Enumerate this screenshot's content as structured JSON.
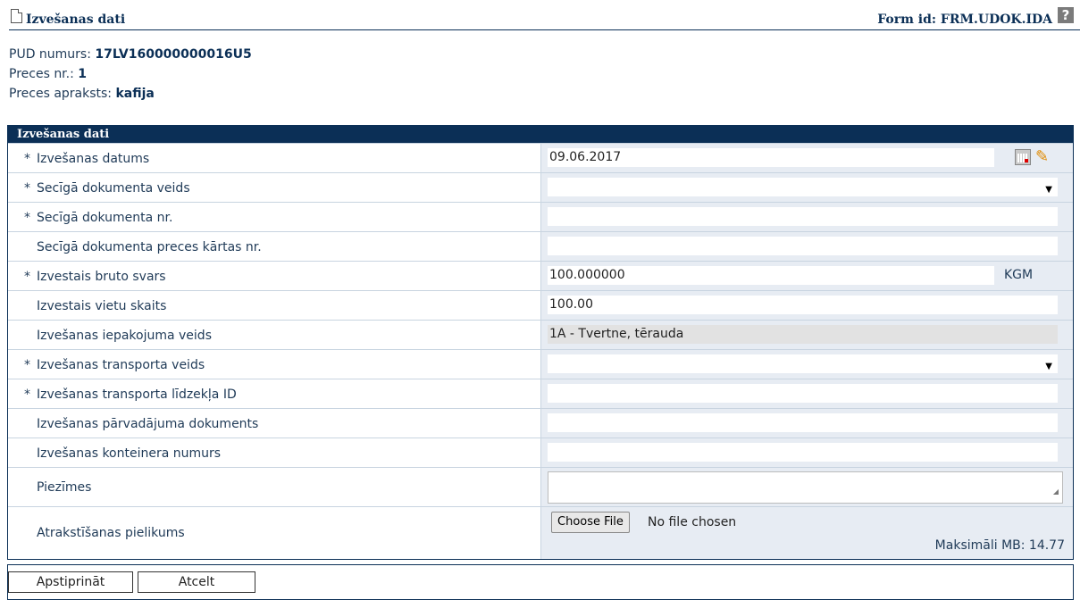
{
  "header": {
    "title": "Izvešanas dati",
    "form_id": "Form id: FRM.UDOK.IDA",
    "help_label": "?"
  },
  "info": {
    "pud_label": "PUD numurs:",
    "pud_value": "17LV160000000016U5",
    "preces_nr_label": "Preces nr.:",
    "preces_nr_value": "1",
    "preces_apraksts_label": "Preces apraksts:",
    "preces_apraksts_value": "kafija"
  },
  "section": {
    "title": "Izvešanas dati"
  },
  "rows": [
    {
      "required": "*",
      "label": "Izvešanas datums",
      "value": "09.06.2017"
    },
    {
      "required": "*",
      "label": "Secīgā dokumenta veids",
      "value": ""
    },
    {
      "required": "*",
      "label": "Secīgā dokumenta nr.",
      "value": ""
    },
    {
      "required": "",
      "label": "Secīgā dokumenta preces kārtas nr.",
      "value": ""
    },
    {
      "required": "*",
      "label": "Izvestais bruto svars",
      "value": "100.000000",
      "unit": "KGM"
    },
    {
      "required": "",
      "label": "Izvestais vietu skaits",
      "value": "100.00"
    },
    {
      "required": "",
      "label": "Izvešanas iepakojuma veids",
      "value": "1A - Tvertne, tērauda"
    },
    {
      "required": "*",
      "label": "Izvešanas transporta veids",
      "value": ""
    },
    {
      "required": "*",
      "label": "Izvešanas transporta līdzekļa ID",
      "value": ""
    },
    {
      "required": "",
      "label": "Izvešanas pārvadājuma dokuments",
      "value": ""
    },
    {
      "required": "",
      "label": "Izvešanas konteinera numurs",
      "value": ""
    },
    {
      "required": "",
      "label": "Piezīmes",
      "value": ""
    },
    {
      "required": "",
      "label": "Atrakstīšanas pielikums",
      "choose_file": "Choose File",
      "no_file": "No file chosen",
      "max_mb": "Maksimāli MB: 14.77"
    }
  ],
  "icons": {
    "calendar": "calendar-icon",
    "clear": "pencil-icon",
    "dropdown": "▼"
  },
  "footer": {
    "confirm_label": "Apstiprināt",
    "cancel_label": "Atcelt"
  },
  "colors": {
    "header_blue": "#0b2f56",
    "field_bg": "#e7ecf3",
    "row_border": "#c8d4e0"
  }
}
